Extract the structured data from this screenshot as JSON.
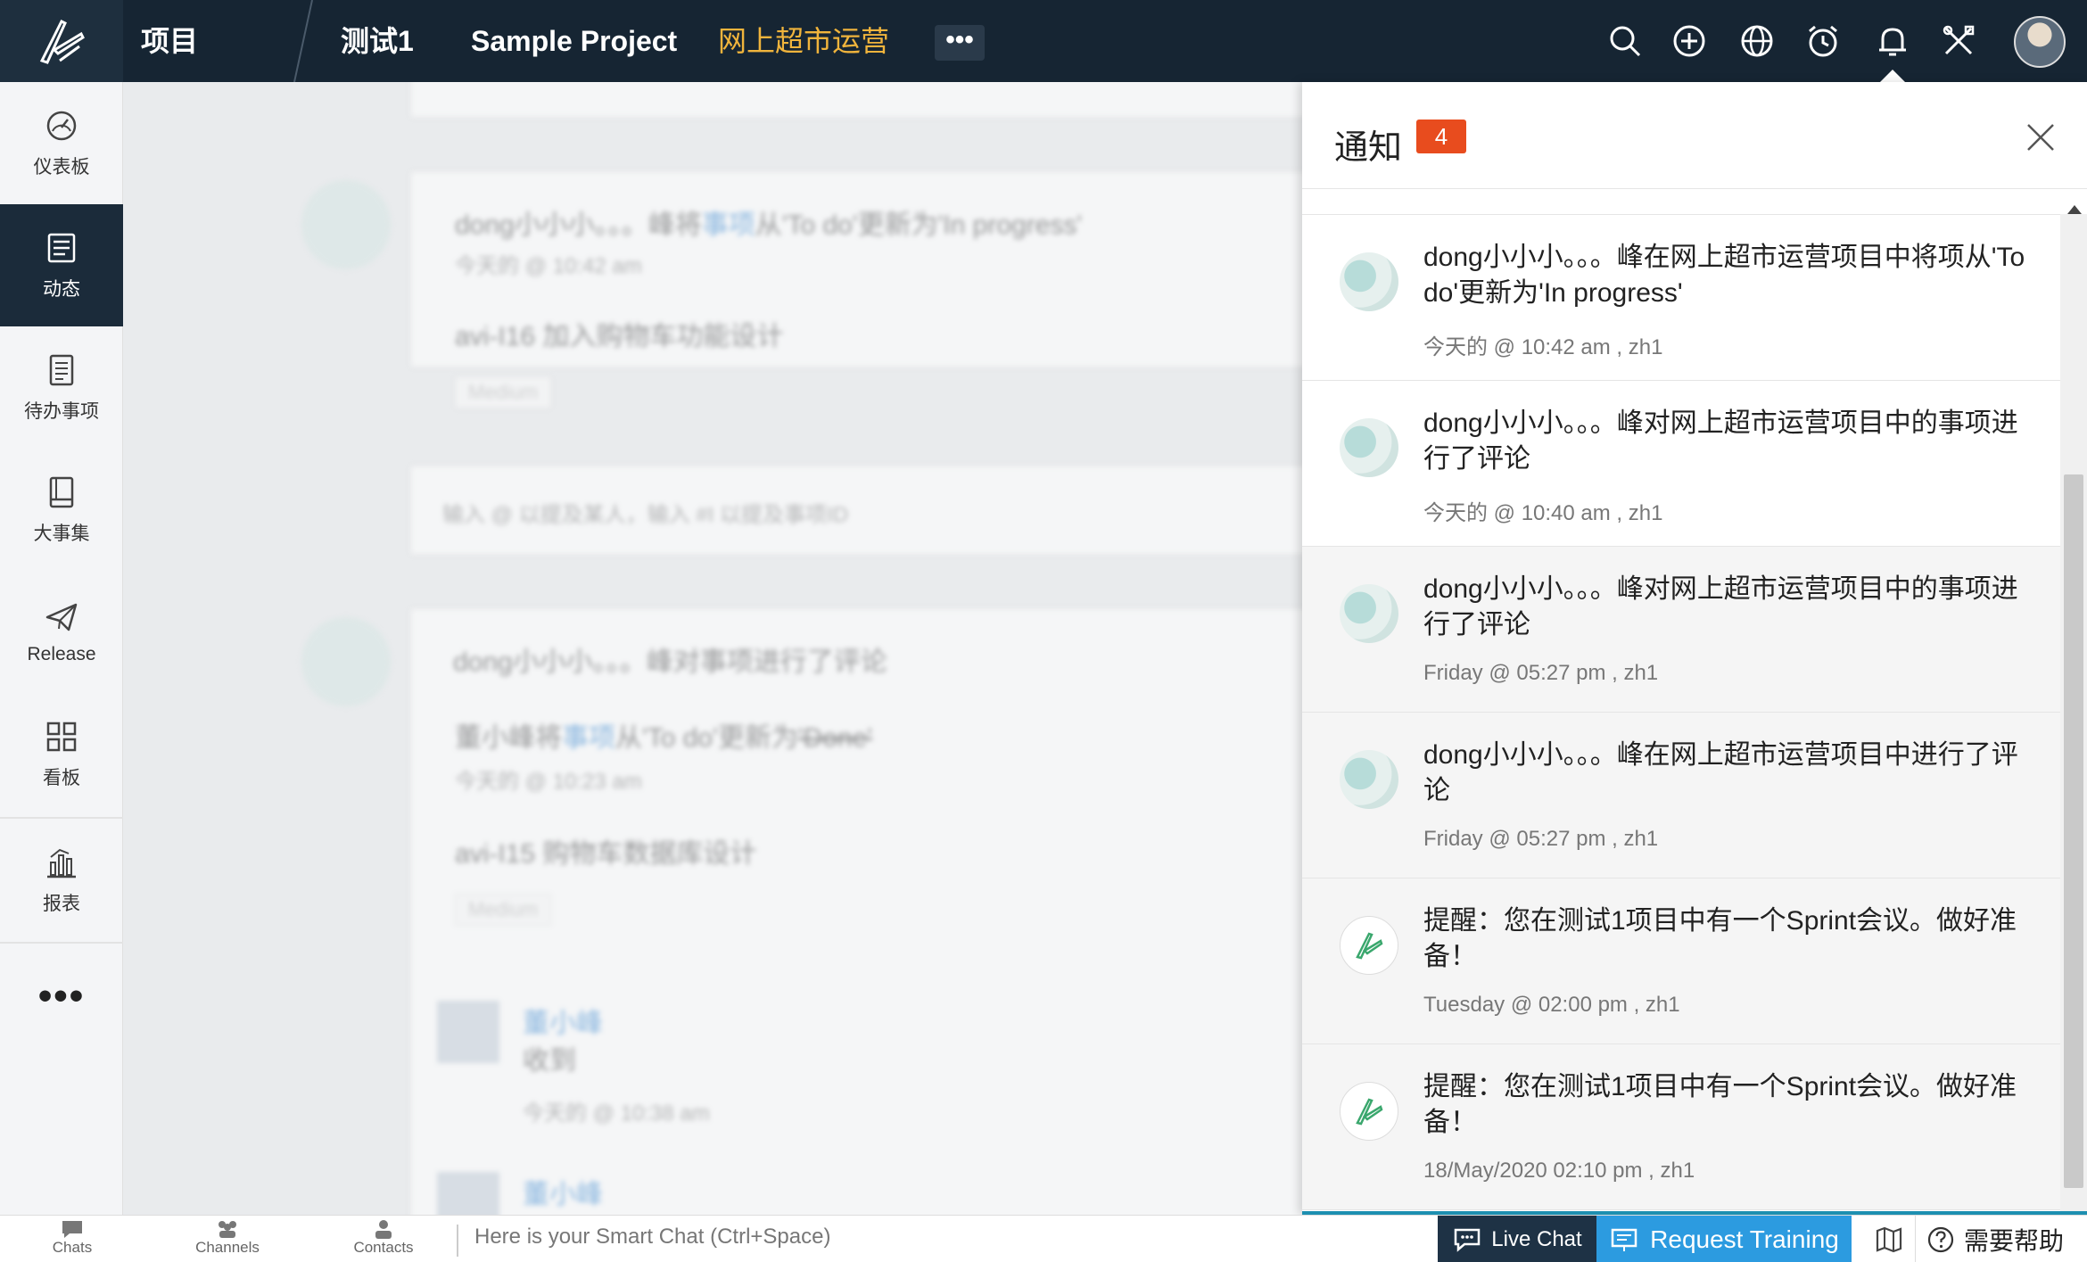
{
  "topbar": {
    "nav": [
      "项目",
      "测试1",
      "Sample Project",
      "网上超市运营"
    ],
    "more_label": "•••"
  },
  "sidebar": {
    "items": [
      {
        "label": "仪表板",
        "icon": "dashboard-icon"
      },
      {
        "label": "动态",
        "icon": "feed-icon"
      },
      {
        "label": "待办事项",
        "icon": "backlog-icon"
      },
      {
        "label": "大事集",
        "icon": "epic-icon"
      },
      {
        "label": "Release",
        "icon": "release-icon"
      },
      {
        "label": "看板",
        "icon": "board-icon"
      },
      {
        "label": "报表",
        "icon": "report-icon"
      }
    ],
    "more_label": "•••"
  },
  "feed": {
    "item1_text_a": "dong小小小。。。峰将",
    "item1_link": "事项",
    "item1_text_b": "从'To do'更新为'In progress'",
    "item1_time": "今天的 @ 10:42 am",
    "item1_task": "avi-I16 加入购物车功能设计",
    "item1_priority": "Medium",
    "comment_placeholder": "输入 @ 以提及某人，输入 #I 以提及事项ID",
    "item2_header": "dong小小小。。。峰对事项进行了评论",
    "item2_text_a": "董小峰将",
    "item2_link": "事项",
    "item2_text_b": "从'To do'更新为",
    "item2_strike": "'Done'",
    "item2_time": "今天的 @ 10:23 am",
    "item2_task": "avi-I15 购物车数据库设计",
    "item2_priority": "Medium",
    "comment_user": "董小峰",
    "comment_text": "收到",
    "comment_time": "今天的 @ 10:38 am",
    "comment_user2": "董小峰"
  },
  "panel": {
    "title": "通知",
    "count": "4",
    "notifications": [
      {
        "text": "dong小小小。。。峰在网上超市运营项目中将项从'To do'更新为'In progress'",
        "time": "今天的 @ 10:42 am , zh1",
        "unread": false,
        "type": "user"
      },
      {
        "text": "dong小小小。。。峰对网上超市运营项目中的事项进行了评论",
        "time": "今天的 @ 10:40 am , zh1",
        "unread": false,
        "type": "user"
      },
      {
        "text": "dong小小小。。。峰对网上超市运营项目中的事项进行了评论",
        "time": "Friday @ 05:27 pm , zh1",
        "unread": true,
        "type": "user"
      },
      {
        "text": "dong小小小。。。峰在网上超市运营项目中进行了评论",
        "time": "Friday @ 05:27 pm , zh1",
        "unread": true,
        "type": "user"
      },
      {
        "text": "提醒：您在测试1项目中有一个Sprint会议。做好准备！",
        "time": "Tuesday @ 02:00 pm , zh1",
        "unread": true,
        "type": "app"
      },
      {
        "text": "提醒：您在测试1项目中有一个Sprint会议。做好准备！",
        "time": "18/May/2020 02:10 pm , zh1",
        "unread": true,
        "type": "app"
      }
    ]
  },
  "bottombar": {
    "tabs": [
      "Chats",
      "Channels",
      "Contacts"
    ],
    "smart_chat": "Here is your Smart Chat (Ctrl+Space)",
    "live_chat": "Live Chat",
    "request_training": "Request Training",
    "help": "需要帮助"
  },
  "colors": {
    "topbar": "#162533",
    "active_project": "#f0b43c",
    "badge": "#e84c1e",
    "training": "#2c9be0"
  }
}
